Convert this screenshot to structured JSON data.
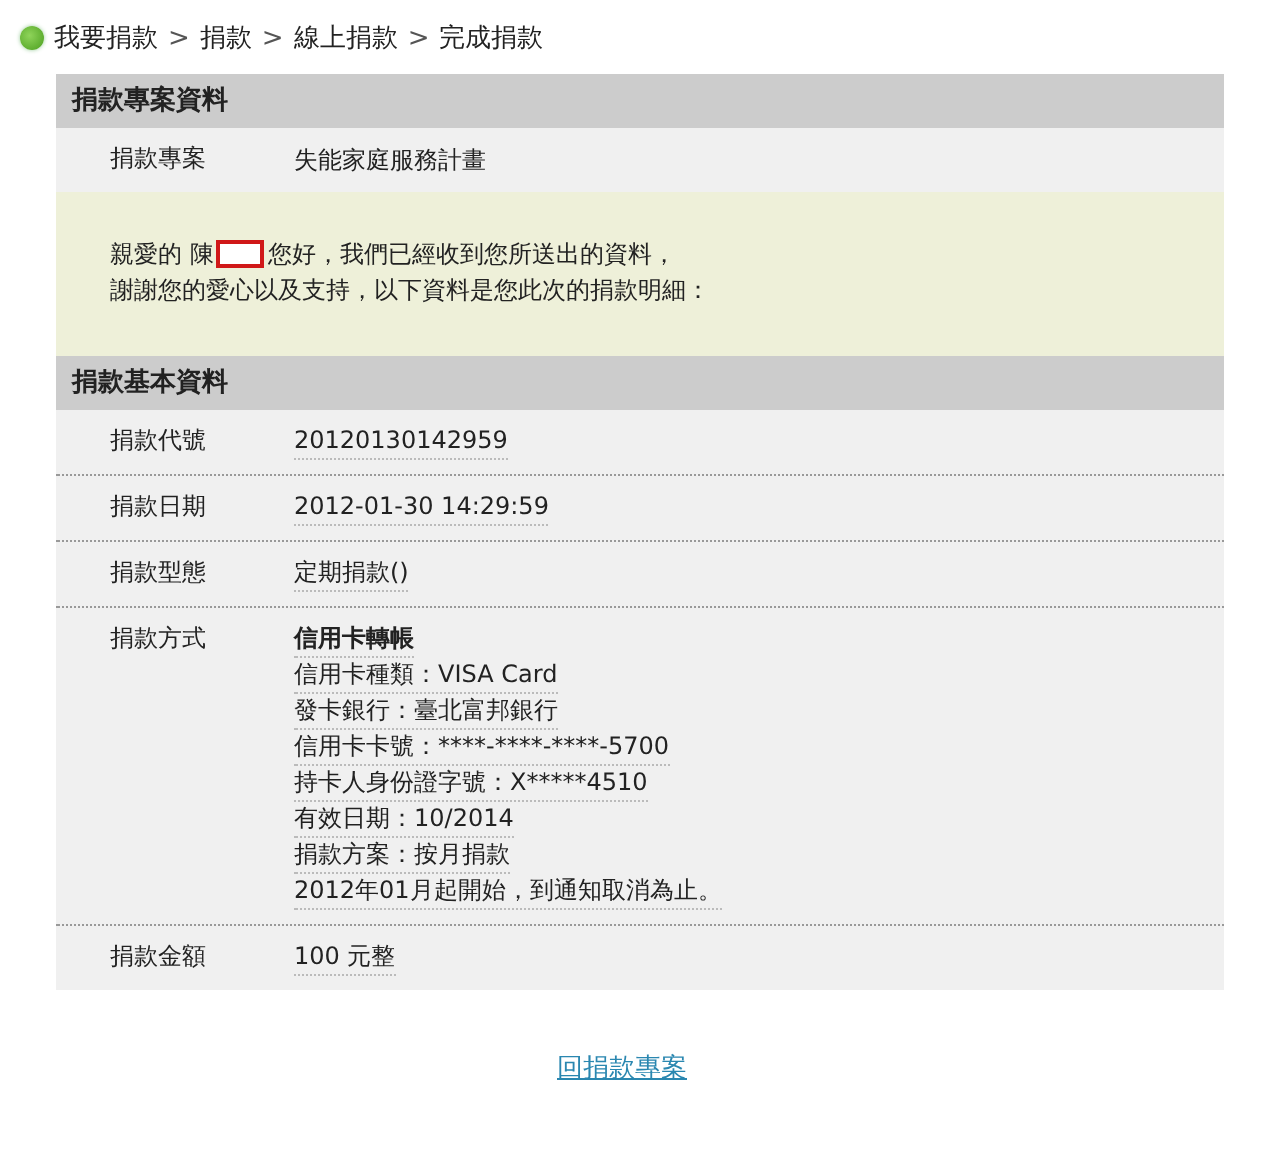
{
  "breadcrumb": [
    {
      "kind": "link",
      "text": "我要捐款"
    },
    {
      "kind": "separator",
      "text": ">"
    },
    {
      "kind": "link",
      "text": "捐款"
    },
    {
      "kind": "separator",
      "text": ">"
    },
    {
      "kind": "link",
      "text": "線上捐款"
    },
    {
      "kind": "separator",
      "text": ">"
    },
    {
      "kind": "current",
      "text": "完成捐款"
    }
  ],
  "blocks": [
    {
      "kind": "header",
      "title": "捐款專案資料"
    },
    {
      "kind": "row",
      "label": "捐款專案",
      "lines": [
        {
          "text": "失能家庭服務計畫",
          "bold": false
        }
      ],
      "underline": false
    },
    {
      "kind": "message",
      "greeting_before": "親愛的 陳",
      "redacted": true,
      "greeting_after": "您好，我們已經收到您所送出的資料，",
      "line_2": "謝謝您的愛心以及支持，以下資料是您此次的捐款明細："
    },
    {
      "kind": "header",
      "title": "捐款基本資料"
    },
    {
      "kind": "row",
      "label": "捐款代號",
      "lines": [
        {
          "text": "20120130142959",
          "bold": false
        }
      ],
      "underline": true
    },
    {
      "kind": "row",
      "label": "捐款日期",
      "lines": [
        {
          "text": "2012-01-30 14:29:59",
          "bold": false
        }
      ],
      "underline": true
    },
    {
      "kind": "row",
      "label": "捐款型態",
      "lines": [
        {
          "text": "定期捐款()",
          "bold": false
        }
      ],
      "underline": true
    },
    {
      "kind": "row",
      "label": "捐款方式",
      "lines": [
        {
          "text": "信用卡轉帳",
          "bold": true
        },
        {
          "text": "信用卡種類：VISA Card",
          "bold": false
        },
        {
          "text": "發卡銀行：臺北富邦銀行",
          "bold": false
        },
        {
          "text": "信用卡卡號：****-****-****-5700",
          "bold": false
        },
        {
          "text": "持卡人身份證字號：X*****4510",
          "bold": false
        },
        {
          "text": "有效日期：10/2014",
          "bold": false
        },
        {
          "text": "捐款方案：按月捐款",
          "bold": false
        },
        {
          "text": "2012年01月起開始，到通知取消為止。",
          "bold": false
        }
      ],
      "underline": true
    },
    {
      "kind": "row",
      "label": "捐款金額",
      "lines": [
        {
          "text": "100 元整",
          "bold": false
        }
      ],
      "underline": true
    }
  ],
  "back_link": "回捐款專案"
}
